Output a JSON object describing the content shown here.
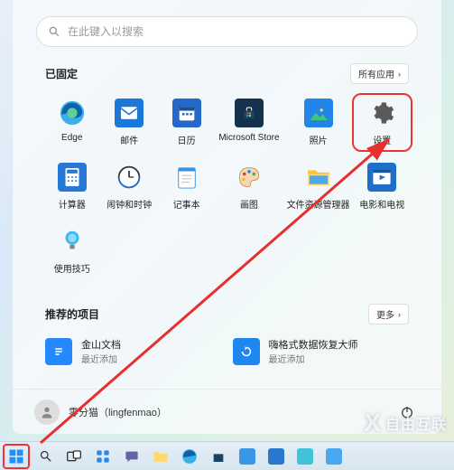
{
  "search": {
    "placeholder": "在此键入以搜索"
  },
  "pinned": {
    "title": "已固定",
    "action": "所有应用",
    "apps": [
      {
        "label": "Edge"
      },
      {
        "label": "邮件"
      },
      {
        "label": "日历"
      },
      {
        "label": "Microsoft Store"
      },
      {
        "label": "照片"
      },
      {
        "label": "设置"
      },
      {
        "label": "计算器"
      },
      {
        "label": "闹钟和时钟"
      },
      {
        "label": "记事本"
      },
      {
        "label": "画图"
      },
      {
        "label": "文件资源管理器"
      },
      {
        "label": "电影和电视"
      },
      {
        "label": "使用技巧"
      }
    ]
  },
  "recommended": {
    "title": "推荐的项目",
    "action": "更多",
    "items": [
      {
        "title": "金山文档",
        "subtitle": "最近添加"
      },
      {
        "title": "嗨格式数据恢复大师",
        "subtitle": "最近添加"
      }
    ]
  },
  "user": {
    "name": "零分猫（lingfenmao）"
  },
  "watermark": "自由互联",
  "colors": {
    "edge": "#1e88d8",
    "mail": "#0f6cbd",
    "calendar": "#2266cc",
    "store": "#10304c",
    "photos": "#1f7de0",
    "settings": "#5a5a5a",
    "calc": "#2077d4",
    "clock": "#1b74d0",
    "notepad": "#2888dd",
    "paint": "#ffffff",
    "explorer": "#2a85d8",
    "movies": "#1d6fc8",
    "tips": "#2078e4",
    "wps": "#2688ff",
    "recover": "#1e88f0"
  }
}
